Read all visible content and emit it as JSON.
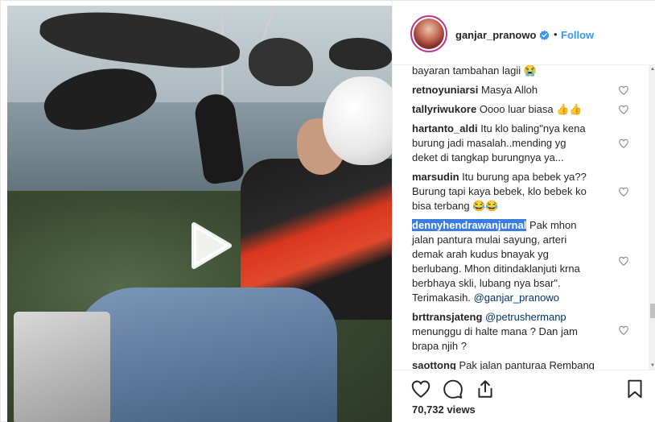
{
  "header": {
    "username": "ganjar_pranowo",
    "separator": "•",
    "follow_label": "Follow"
  },
  "comments": [
    {
      "user": "",
      "lines": [
        "bayaran tambahan lagii 😭"
      ],
      "heart": false
    },
    {
      "user": "retnoyuniarsi",
      "lines": [
        "Masya Alloh"
      ],
      "heart": true
    },
    {
      "user": "tallyriwukore",
      "lines": [
        "Oooo luar biasa 👍👍"
      ],
      "heart": true
    },
    {
      "user": "hartanto_aldi",
      "lines": [
        "Itu klo baling\"nya kena",
        "burung jadi masalah..mending yg",
        "deket di tangkap burungnya ya..."
      ],
      "heart": true
    },
    {
      "user": "marsudin",
      "lines": [
        "Itu burung apa bebek ya??",
        "Burung tapi kaya bebek, klo bebek ko",
        "bisa terbang 😂😂"
      ],
      "heart": true
    },
    {
      "user": "dennyhendrawanjurnal",
      "lines": [
        "Pak mhon",
        "jalan pantura mulai sayung, arteri",
        "demak arah kudus bnayak yg",
        "berlubang. Mhon ditindaklanjuti krna",
        "berbhaya skli, lubang nya bsar\".",
        "Terimakasih."
      ],
      "mention": "@ganjar_pranowo",
      "heart": true
    },
    {
      "user": "brttransjateng",
      "mention": "@petrushermanp",
      "lines": [
        "menunggu di halte mana ? Dan jam",
        "brapa njih ?"
      ],
      "heart": true
    },
    {
      "user": "saottong",
      "lines": [
        "Pak jalan panturaa Rembang"
      ],
      "heart": false
    }
  ],
  "footer": {
    "views": "70,732 views"
  },
  "icons": {
    "play": "play-icon",
    "like": "heart-icon",
    "comment": "comment-icon",
    "share": "share-icon",
    "save": "bookmark-icon",
    "verified": "verified-badge-icon"
  },
  "colors": {
    "link": "#3897f0",
    "verified": "#3897f0",
    "highlight": "#3a7ce0",
    "text": "#262626"
  }
}
